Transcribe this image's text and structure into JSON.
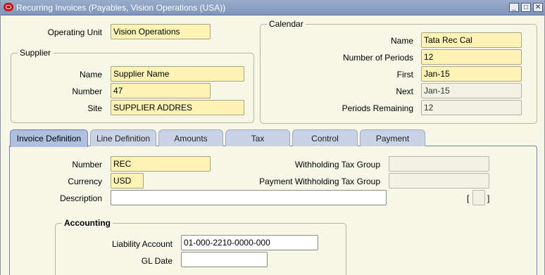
{
  "window": {
    "title": "Recurring Invoices (Payables, Vision Operations (USA))",
    "minimize_glyph": "_",
    "maximize_glyph": "□",
    "close_glyph": "✕"
  },
  "header": {
    "operating_unit_label": "Operating Unit",
    "operating_unit_value": "Vision Operations"
  },
  "supplier": {
    "group_title": "Supplier",
    "name_label": "Name",
    "name_value": "Supplier Name",
    "number_label": "Number",
    "number_value": "47",
    "site_label": "Site",
    "site_value": "SUPPLIER ADDRES"
  },
  "calendar": {
    "group_title": "Calendar",
    "name_label": "Name",
    "name_value": "Tata Rec Cal",
    "periods_label": "Number of Periods",
    "periods_value": "12",
    "first_label": "First",
    "first_value": "Jan-15",
    "next_label": "Next",
    "next_value": "Jan-15",
    "remaining_label": "Periods Remaining",
    "remaining_value": "12"
  },
  "tabs": [
    {
      "label": "Invoice Definition",
      "active": true
    },
    {
      "label": "Line Definition",
      "active": false
    },
    {
      "label": "Amounts",
      "active": false
    },
    {
      "label": "Tax",
      "active": false
    },
    {
      "label": "Control",
      "active": false
    },
    {
      "label": "Payment",
      "active": false
    }
  ],
  "invoice_definition": {
    "number_label": "Number",
    "number_value": "REC",
    "currency_label": "Currency",
    "currency_value": "USD",
    "description_label": "Description",
    "description_value": "",
    "wht_group_label": "Withholding Tax Group",
    "wht_group_value": "",
    "pay_wht_group_label": "Payment Withholding Tax Group",
    "pay_wht_group_value": "",
    "dff_open": "[",
    "dff_close": "]"
  },
  "accounting": {
    "group_title": "Accounting",
    "liability_label": "Liability Account",
    "liability_value": "01-000-2210-0000-000",
    "gl_date_label": "GL Date",
    "gl_date_value": ""
  },
  "colors": {
    "required_field": "#fdf3b5",
    "titlebar": "#8da2c6",
    "active_tab": "#aec0df",
    "background": "#f7f7e7"
  }
}
